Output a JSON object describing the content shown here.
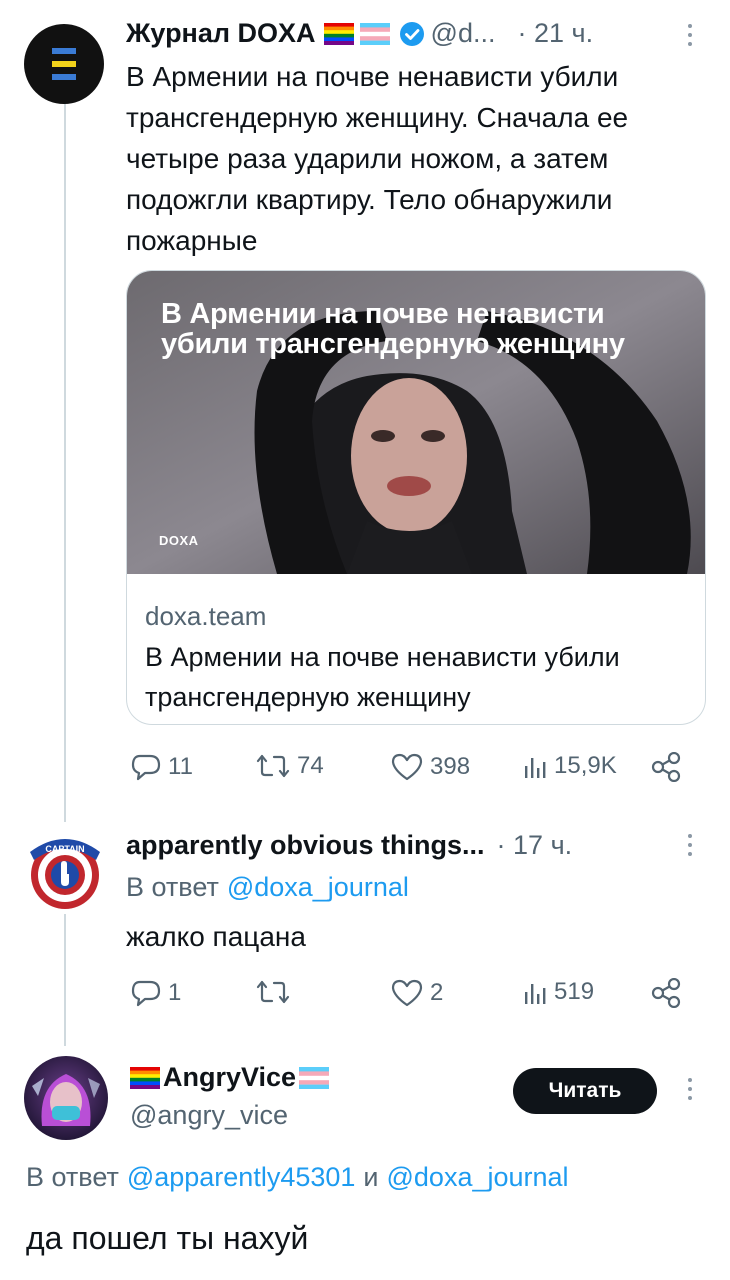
{
  "tweet1": {
    "author_name": "Журнал DOXA",
    "handle": "@d...",
    "time": "· 21 ч.",
    "text": "В Армении на почве ненависти убили трансгендерную женщину. Сначала ее четыре раза ударили ножом, а затем подожгли квартиру. Тело обнаружили пожарные",
    "card": {
      "headline": "В Армении на почве ненависти убили трансгендерную женщину",
      "logo_text": "DOXA",
      "domain": "doxa.team",
      "title": "В Армении на почве ненависти убили трансгендерную женщину"
    },
    "stats": {
      "replies": "11",
      "retweets": "74",
      "likes": "398",
      "views": "15,9K"
    }
  },
  "tweet2": {
    "author_name": "apparently obvious things...",
    "time": "· 17 ч.",
    "reply_prefix": "В ответ",
    "reply_to": "@doxa_journal",
    "text": "жалко пацана",
    "avatar_text": "CAPTAIN",
    "stats": {
      "replies": "1",
      "retweets": "",
      "likes": "2",
      "views": "519"
    }
  },
  "tweet3": {
    "author_name": "AngryVice",
    "handle": "@angry_vice",
    "follow_label": "Читать",
    "reply_prefix": "В ответ",
    "reply_to_1": "@apparently45301",
    "reply_join": "и",
    "reply_to_2": "@doxa_journal",
    "text": "да пошел ты нахуй"
  },
  "colors": {
    "accent": "#1d9bf0",
    "text": "#0f1419",
    "muted": "#536471",
    "border": "#cfd9de"
  },
  "icons": [
    "reply-icon",
    "retweet-icon",
    "like-icon",
    "views-icon",
    "share-icon",
    "more-icon",
    "verified-icon",
    "rainbow-flag-icon",
    "trans-flag-icon"
  ]
}
